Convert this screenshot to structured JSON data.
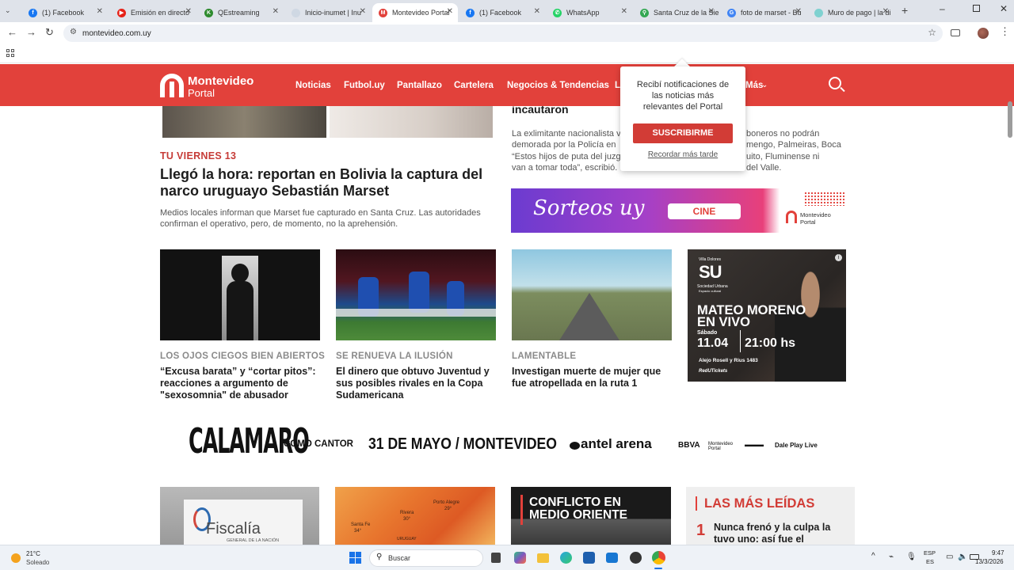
{
  "browser": {
    "tabs": [
      {
        "title": "(1) Facebook",
        "color": "#1877f2",
        "glyph": "f"
      },
      {
        "title": "Emisión en directo",
        "color": "#e62117",
        "glyph": "▶"
      },
      {
        "title": "QEstreaming",
        "color": "#2e8b2e",
        "glyph": "K"
      },
      {
        "title": "Inicio-inumet | Inu",
        "color": "#cfd8e3",
        "glyph": ""
      },
      {
        "title": "Montevideo Portal",
        "color": "#e2413b",
        "glyph": "M"
      },
      {
        "title": "(1) Facebook",
        "color": "#1877f2",
        "glyph": "f"
      },
      {
        "title": "WhatsApp",
        "color": "#25d366",
        "glyph": "✆"
      },
      {
        "title": "Santa Cruz de la Sie",
        "color": "#34a853",
        "glyph": "⚲"
      },
      {
        "title": "foto de marset - Bu",
        "color": "#4285f4",
        "glyph": "G"
      },
      {
        "title": "Muro de pago | la di",
        "color": "#7fd1d0",
        "glyph": ""
      }
    ],
    "url": "montevideo.com.uy"
  },
  "site": {
    "logo_line1": "Montevideo",
    "logo_line2": "Portal",
    "nav": [
      "Noticias",
      "Futbol.uy",
      "Pantallazo",
      "Cartelera",
      "Negocios & Tendencias",
      "L",
      "Más"
    ],
    "brand_color": "#e2413b"
  },
  "notification": {
    "message": "Recibí notificaciones de las noticias más relevantes del Portal",
    "subscribe": "SUSCRIBIRME",
    "later": "Recordar más tarde"
  },
  "top_story": {
    "kicker": "TU VIERNES 13",
    "headline": "Llegó la hora: reportan en Bolivia la captura del narco uruguayo Sebastián Marset",
    "summary": "Medios locales informan que Marset fue capturado en Santa Cruz. Las autoridades confirman el operativo, pero, de momento, no la aprehensión."
  },
  "side_story": {
    "headline_tail": "incautaron",
    "summary_lines": [
      "La exlimitante nacionalista v",
      "demorada por la Policía en",
      "“Estos hijos de puta del juzg",
      "van a tomar toda”, escribió."
    ],
    "summary_right": [
      "boneros no podrán",
      "mengo, Palmeiras, Boca",
      "uito, Fluminense ni",
      "del Valle."
    ]
  },
  "sorteos_banner": {
    "title": "Sorteos uy",
    "button": "CINE",
    "brand1": "Montevideo",
    "brand2": "Portal"
  },
  "cards": [
    {
      "kicker": "LOS OJOS CIEGOS BIEN ABIERTOS",
      "headline": "“Excusa barata” y “cortar pitos”: reacciones a argumento de \"sexosomnia\" de abusador"
    },
    {
      "kicker": "SE RENUEVA LA ILUSIÓN",
      "headline": "El dinero que obtuvo Juventud y sus posibles rivales en la Copa Sudamericana"
    },
    {
      "kicker": "LAMENTABLE",
      "headline": "Investigan muerte de mujer que fue atropellada en la ruta 1"
    }
  ],
  "event_ad": {
    "venue1": "Villa Dolores",
    "logo": "SU",
    "venue2": "Sociedad Urbana",
    "venue3": "Espacio cultural",
    "title1": "MATEO MORENO",
    "title2": "EN VIVO",
    "day": "Sábado",
    "date": "11.04",
    "time": "21:00 hs",
    "address": "Alejo Rosell y Rius 1483",
    "sponsor": "RedUTickets"
  },
  "calamaro_banner": {
    "artist": "CALAMARO",
    "tagline": "COMO CANTOR",
    "date": "31 DE MAYO / MONTEVIDEO",
    "venue": "antel arena",
    "sponsors": [
      "BBVA",
      "Montevideo Portal",
      "▬▬▬",
      "Dale Play Live"
    ]
  },
  "bottom_cards": {
    "fiscalia_text": "Fiscalía",
    "fiscalia_sub": "GENERAL DE LA NACIÓN",
    "map_labels": [
      "Porto Alegre",
      "Rivera",
      "Santa Fe",
      "URUGUAY"
    ],
    "map_temps": [
      "29°",
      "30°",
      "34°"
    ],
    "conflict_title": "CONFLICTO EN MEDIO ORIENTE"
  },
  "most_read": {
    "title": "LAS MÁS LEÍDAS",
    "items": [
      {
        "rank": "1",
        "headline": "Nunca frenó y la culpa la tuvo uno: así fue el"
      }
    ]
  },
  "taskbar": {
    "weather_temp": "21°C",
    "weather_desc": "Soleado",
    "search_placeholder": "Buscar",
    "lang1": "ESP",
    "lang2": "ES",
    "time": "9:47",
    "date": "13/3/2026"
  }
}
